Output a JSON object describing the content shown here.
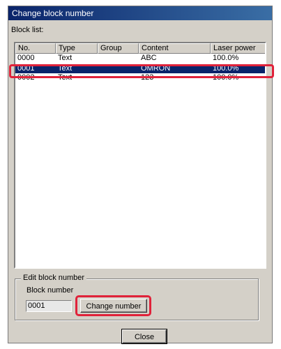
{
  "window": {
    "title": "Change block number"
  },
  "block_list": {
    "label": "Block list:",
    "columns": [
      "No.",
      "Type",
      "Group",
      "Content",
      "Laser power"
    ],
    "rows": [
      {
        "no": "0000",
        "type": "Text",
        "group": "",
        "content": "ABC",
        "laser_power": "100.0%",
        "selected": false
      },
      {
        "no": "0001",
        "type": "Text",
        "group": "",
        "content": "OMRON",
        "laser_power": "100.0%",
        "selected": true
      },
      {
        "no": "0002",
        "type": "Text",
        "group": "",
        "content": "123",
        "laser_power": "100.0%",
        "selected": false
      }
    ]
  },
  "edit_block": {
    "group_title": "Edit block number",
    "block_number_label": "Block number",
    "block_number_value": "0001",
    "change_button_label": "Change number"
  },
  "footer": {
    "close_label": "Close"
  },
  "colors": {
    "highlight": "#e0223a",
    "selection": "#0a246a",
    "dialog_bg": "#d4d0c8"
  }
}
